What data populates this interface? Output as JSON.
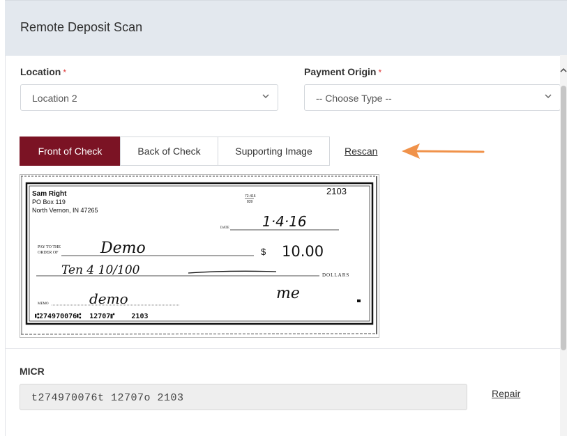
{
  "header": {
    "title": "Remote Deposit Scan"
  },
  "location": {
    "label": "Location",
    "required_mark": "*",
    "selected": "Location 2"
  },
  "payment_origin": {
    "label": "Payment Origin",
    "required_mark": "*",
    "selected": "-- Choose Type --"
  },
  "tabs": [
    {
      "label": "Front of Check",
      "active": true
    },
    {
      "label": "Back of Check",
      "active": false
    },
    {
      "label": "Supporting Image",
      "active": false
    }
  ],
  "rescan_label": "Rescan",
  "arrow_color": "#f0924a",
  "accent_color": "#7b1324",
  "check": {
    "name": "Sam Right",
    "address1": "PO Box 119",
    "address2": "North Vernon, IN 47265",
    "routing_fraction_top": "72-416",
    "routing_fraction_bottom": "839",
    "number": "2103",
    "date_label": "DATE",
    "date": "1·4·16",
    "payto_label_1": "PAY TO THE",
    "payto_label_2": "ORDER OF",
    "payee": "Demo",
    "dollar_sign": "$",
    "amount": "10.00",
    "written_amount": "Ten  4 10/100",
    "dollars_label": "DOLLARS",
    "memo_label": "MEMO",
    "memo": "demo",
    "signature": "me",
    "micr_line": "⑆274970076⑆  12707⑈    2103"
  },
  "micr": {
    "label": "MICR",
    "value": "t274970076t 12707o 2103"
  },
  "repair_label": "Repair"
}
